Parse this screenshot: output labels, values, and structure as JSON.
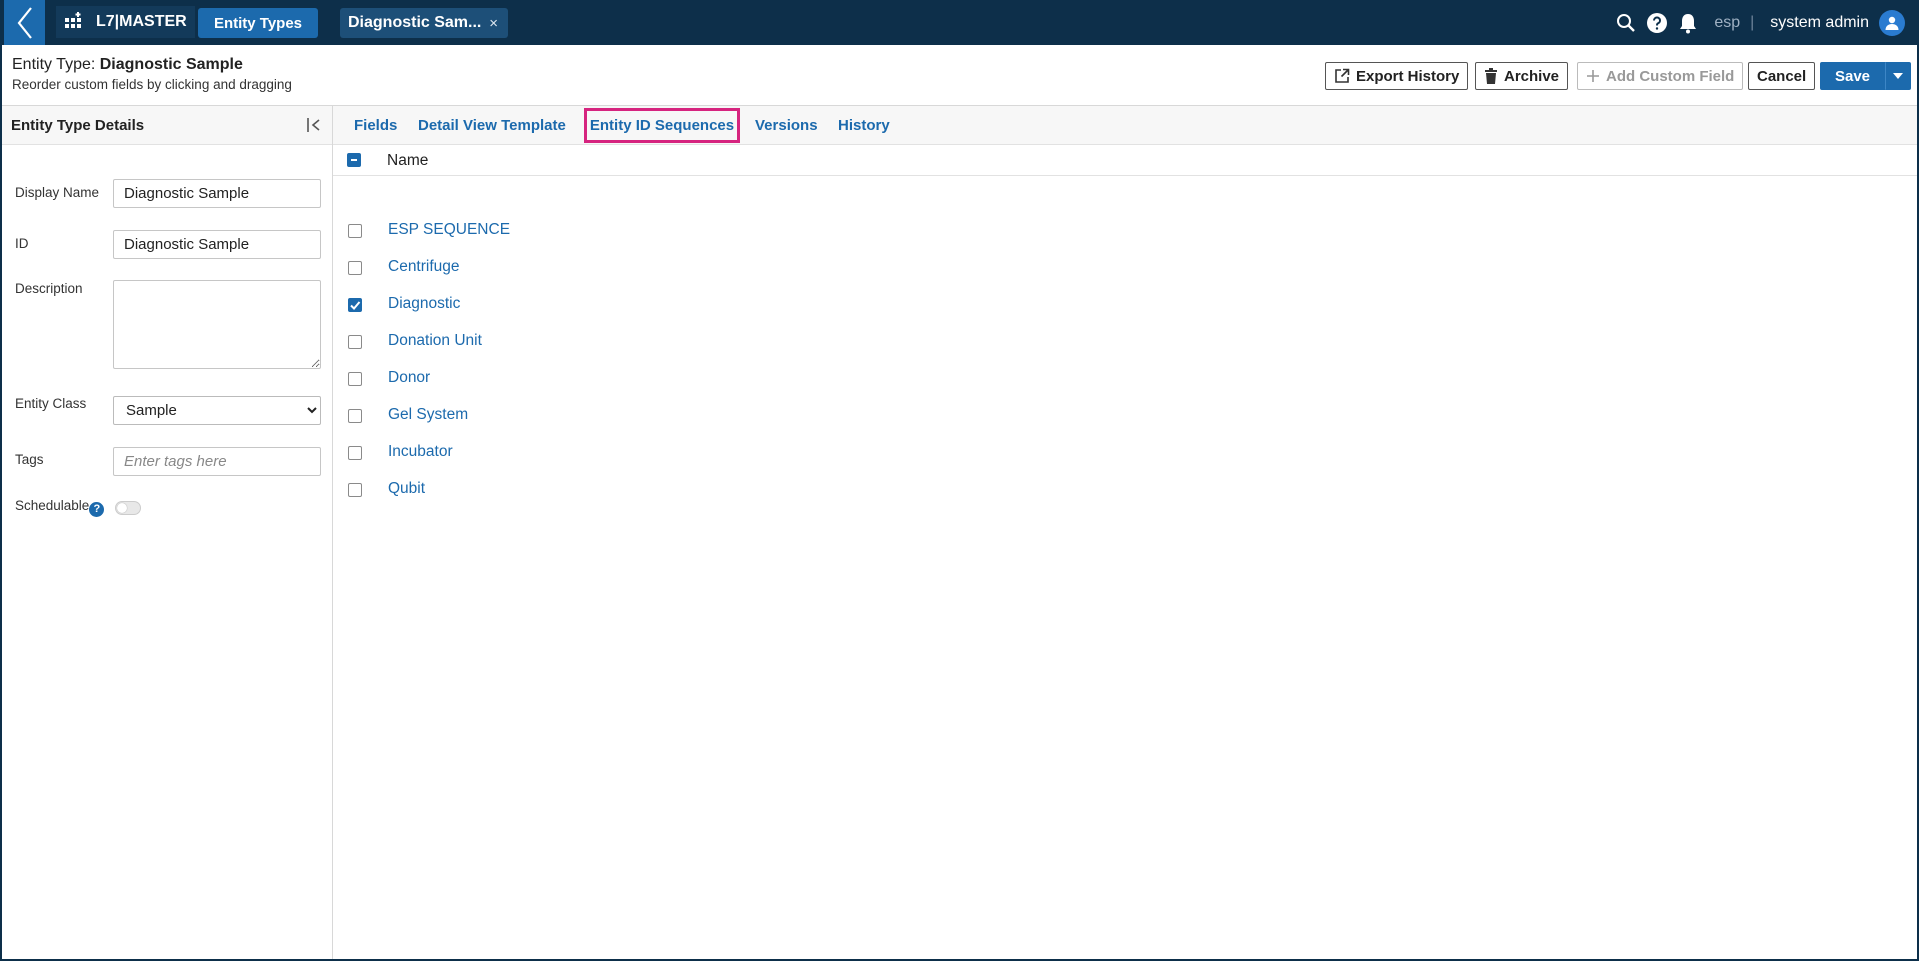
{
  "topbar": {
    "app_name": "L7|MASTER",
    "nav_tab": "Entity Types",
    "doc_tab": "Diagnostic Sam...",
    "doc_tab_close": "×",
    "org": "esp",
    "separator": "|",
    "user": "system admin"
  },
  "header": {
    "title_prefix": "Entity Type: ",
    "title_name": "Diagnostic Sample",
    "subtitle": "Reorder custom fields by clicking and dragging",
    "export_history": "Export History",
    "archive": "Archive",
    "add_custom_field": "Add Custom Field",
    "cancel": "Cancel",
    "save": "Save"
  },
  "sidebar": {
    "title": "Entity Type Details",
    "display_name_label": "Display Name",
    "display_name_value": "Diagnostic Sample",
    "id_label": "ID",
    "id_value": "Diagnostic Sample",
    "description_label": "Description",
    "entity_class_label": "Entity Class",
    "entity_class_value": "Sample",
    "tags_label": "Tags",
    "tags_placeholder": "Enter tags here",
    "schedulable_label": "Schedulable",
    "help_glyph": "?"
  },
  "tabs": {
    "fields": "Fields",
    "detail_view_template": "Detail View Template",
    "entity_id_sequences": "Entity ID Sequences",
    "versions": "Versions",
    "history": "History"
  },
  "table": {
    "header_name": "Name",
    "rows": [
      {
        "name": "ESP SEQUENCE",
        "checked": false
      },
      {
        "name": "Centrifuge",
        "checked": false
      },
      {
        "name": "Diagnostic",
        "checked": true
      },
      {
        "name": "Donation Unit",
        "checked": false
      },
      {
        "name": "Donor",
        "checked": false
      },
      {
        "name": "Gel System",
        "checked": false
      },
      {
        "name": "Incubator",
        "checked": false
      },
      {
        "name": "Qubit",
        "checked": false
      }
    ]
  },
  "colors": {
    "topbar_bg": "#0d2f4a",
    "accent": "#1c6aad",
    "highlight_border": "#d6247f"
  }
}
